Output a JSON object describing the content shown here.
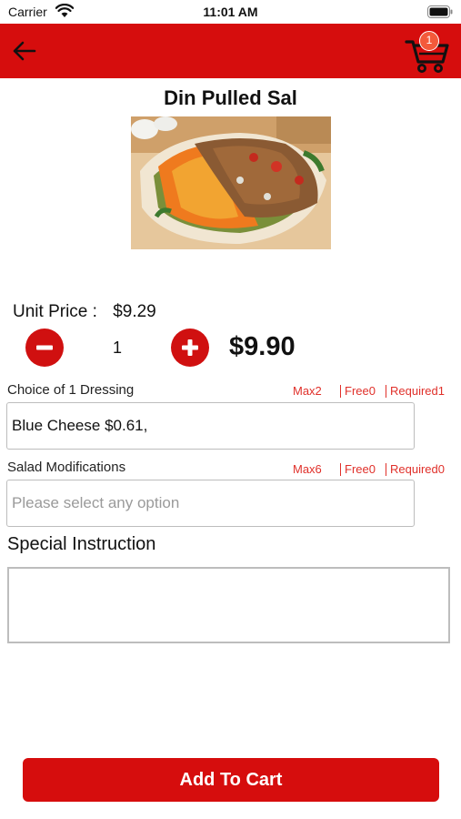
{
  "status_bar": {
    "carrier": "Carrier",
    "time": "11:01 AM"
  },
  "header": {
    "cart_count": "1",
    "accent_color": "#d60d0d"
  },
  "product": {
    "title": "Din Pulled Sal",
    "unit_price_label": "Unit Price :",
    "unit_price": "$9.29",
    "quantity": "1",
    "total": "$9.90"
  },
  "options": [
    {
      "label": "Choice of 1 Dressing",
      "max": "Max2",
      "free": "Free0",
      "required": "Required1",
      "value": "Blue Cheese $0.61,",
      "placeholder": ""
    },
    {
      "label": "Salad Modifications",
      "max": "Max6",
      "free": "Free0",
      "required": "Required0",
      "value": "",
      "placeholder": "Please select any option"
    }
  ],
  "special_instruction": {
    "label": "Special Instruction",
    "value": ""
  },
  "add_to_cart_label": "Add To Cart"
}
